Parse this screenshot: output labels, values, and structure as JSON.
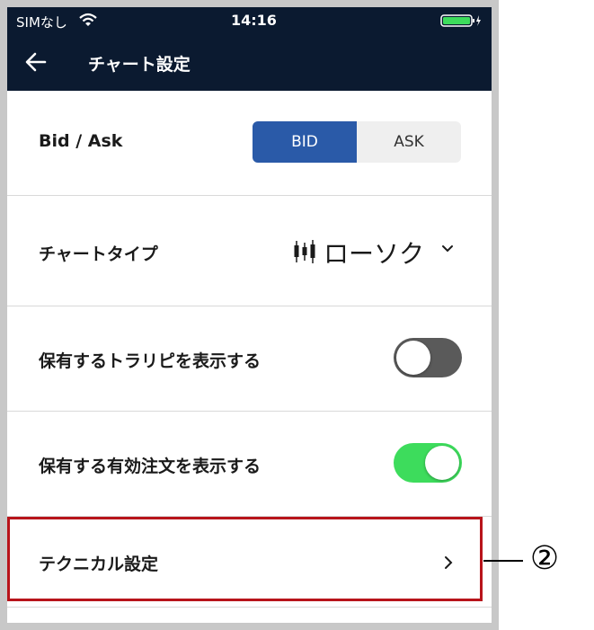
{
  "status_bar": {
    "carrier": "SIMなし",
    "time": "14:16"
  },
  "nav": {
    "title": "チャート設定"
  },
  "bid_ask": {
    "label": "Bid / Ask",
    "options": [
      "BID",
      "ASK"
    ],
    "selected": "BID",
    "accent_color": "#2a5aa8"
  },
  "chart_type": {
    "label": "チャートタイプ",
    "value": "ローソク",
    "icon": "candlestick-icon"
  },
  "show_positions": {
    "label": "保有するトラリピを表示する",
    "enabled": false
  },
  "show_orders": {
    "label": "保有する有効注文を表示する",
    "enabled": true,
    "on_color": "#3ddc5c"
  },
  "technical": {
    "label": "テクニカル設定"
  },
  "callout": {
    "number": "②"
  }
}
